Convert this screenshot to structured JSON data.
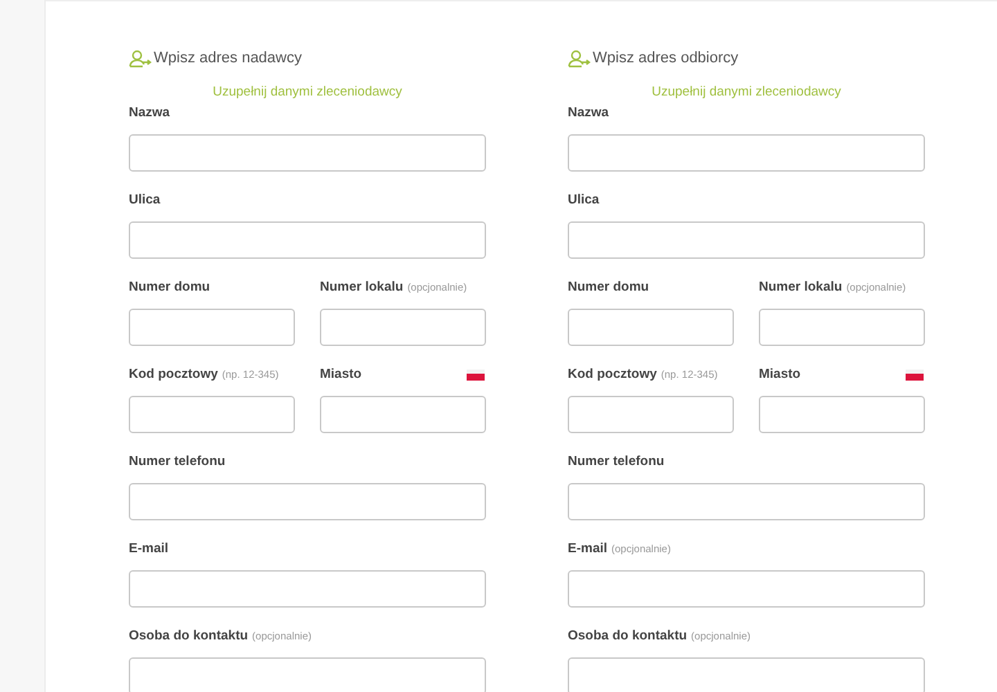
{
  "columns": [
    {
      "heading": "Wpisz adres nadawcy",
      "fill_link": "Uzupełnij danymi zleceniodawcy",
      "rows": [
        [
          {
            "label": "Nazwa"
          }
        ],
        [
          {
            "label": "Ulica"
          }
        ],
        [
          {
            "label": "Numer domu"
          },
          {
            "label": "Numer lokalu",
            "note": "(opcjonalnie)"
          }
        ],
        [
          {
            "label": "Kod pocztowy",
            "note": "(np. 12-345)"
          },
          {
            "label": "Miasto",
            "flag": true
          }
        ],
        [
          {
            "label": "Numer telefonu"
          }
        ],
        [
          {
            "label": "E-mail"
          }
        ],
        [
          {
            "label": "Osoba do kontaktu",
            "note": "(opcjonalnie)"
          }
        ]
      ]
    },
    {
      "heading": "Wpisz adres odbiorcy",
      "fill_link": "Uzupełnij danymi zleceniodawcy",
      "rows": [
        [
          {
            "label": "Nazwa"
          }
        ],
        [
          {
            "label": "Ulica"
          }
        ],
        [
          {
            "label": "Numer domu"
          },
          {
            "label": "Numer lokalu",
            "note": "(opcjonalnie)"
          }
        ],
        [
          {
            "label": "Kod pocztowy",
            "note": "(np. 12-345)"
          },
          {
            "label": "Miasto",
            "flag": true
          }
        ],
        [
          {
            "label": "Numer telefonu"
          }
        ],
        [
          {
            "label": "E-mail",
            "note": "(opcjonalnie)"
          }
        ],
        [
          {
            "label": "Osoba do kontaktu",
            "note": "(opcjonalnie)"
          }
        ]
      ]
    }
  ]
}
